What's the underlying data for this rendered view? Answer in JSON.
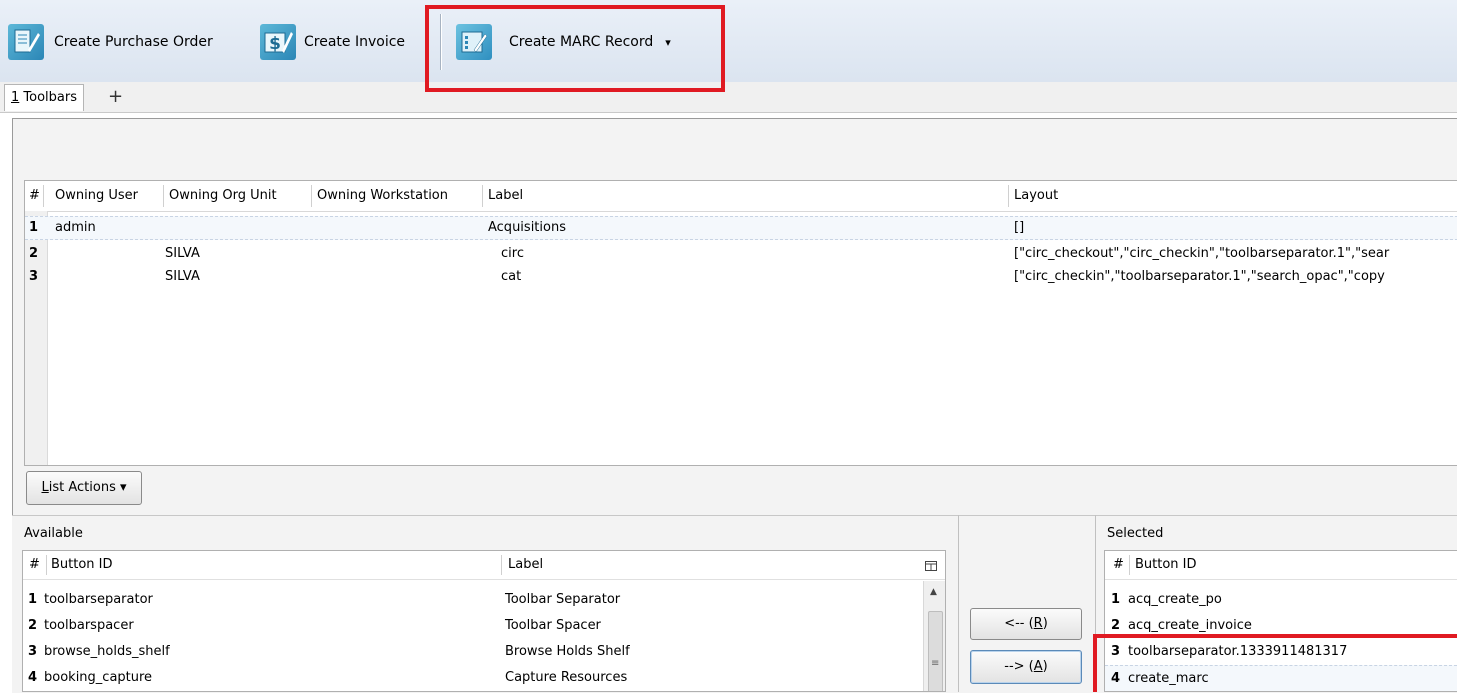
{
  "toolbar": {
    "buttons": [
      {
        "label": "Create Purchase Order",
        "icon": "purchase-order-icon"
      },
      {
        "label": "Create Invoice",
        "icon": "invoice-icon"
      },
      {
        "label": "Create MARC Record",
        "icon": "marc-record-icon",
        "dropdown": "▾"
      }
    ],
    "highlight_color": "#e01a22"
  },
  "tabs": {
    "items": [
      {
        "number": "1",
        "label": " Toolbars"
      }
    ],
    "add_label": "+"
  },
  "toolbar_list": {
    "columns": [
      "#",
      "Owning User",
      "Owning Org Unit",
      "Owning Workstation",
      "Label",
      "Layout"
    ],
    "rows": [
      {
        "num": "1",
        "user": "admin",
        "org": "",
        "ws": "",
        "label": "Acquisitions",
        "layout": "[]"
      },
      {
        "num": "2",
        "user": "",
        "org": "SILVA",
        "ws": "",
        "label": "circ",
        "layout": "[\"circ_checkout\",\"circ_checkin\",\"toolbarseparator.1\",\"sear"
      },
      {
        "num": "3",
        "user": "",
        "org": "SILVA",
        "ws": "",
        "label": "cat",
        "layout": "[\"circ_checkin\",\"toolbarseparator.1\",\"search_opac\",\"copy"
      }
    ],
    "list_actions_label": "List Actions",
    "list_actions_accel": "L",
    "list_actions_rest": "ist Actions ▾"
  },
  "available": {
    "caption": "Available",
    "columns": [
      "#",
      "Button ID",
      "Label"
    ],
    "picker_icon": "column-picker-icon",
    "rows": [
      {
        "num": "1",
        "id": "toolbarseparator",
        "label": "Toolbar Separator"
      },
      {
        "num": "2",
        "id": "toolbarspacer",
        "label": "Toolbar Spacer"
      },
      {
        "num": "3",
        "id": "browse_holds_shelf",
        "label": "Browse Holds Shelf"
      },
      {
        "num": "4",
        "id": "booking_capture",
        "label": "Capture Resources"
      }
    ]
  },
  "move_buttons": {
    "remove_prefix": "<-- (",
    "remove_accel": "R",
    "remove_suffix": ")",
    "add_prefix": "--> (",
    "add_accel": "A",
    "add_suffix": ")"
  },
  "selected": {
    "caption": "Selected",
    "columns": [
      "#",
      "Button ID"
    ],
    "rows": [
      {
        "num": "1",
        "id": "acq_create_po"
      },
      {
        "num": "2",
        "id": "acq_create_invoice"
      },
      {
        "num": "3",
        "id": "toolbarseparator.1333911481317"
      },
      {
        "num": "4",
        "id": "create_marc"
      }
    ]
  }
}
